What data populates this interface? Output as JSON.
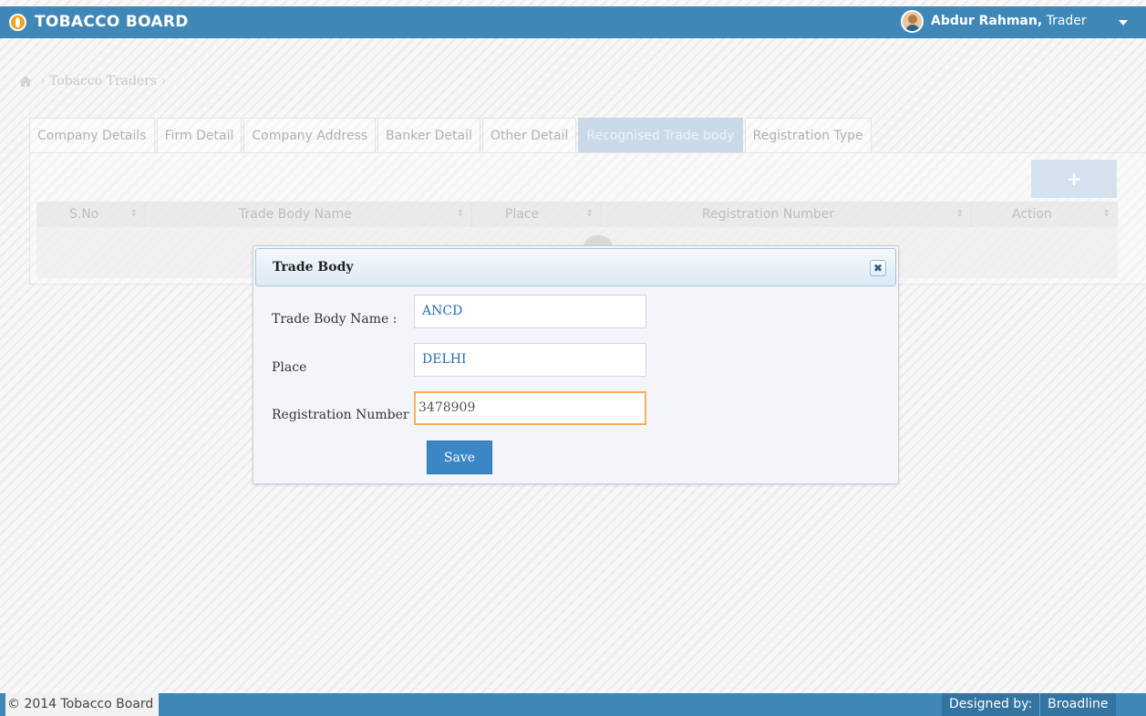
{
  "header": {
    "app_title": "TOBACCO BOARD",
    "user_name": "Abdur Rahman,",
    "user_role": "Trader"
  },
  "breadcrumb": {
    "items": [
      "Tobacco Traders"
    ]
  },
  "tabs": [
    {
      "label": "Company Details",
      "active": false
    },
    {
      "label": "Firm Detail",
      "active": false
    },
    {
      "label": "Company Address",
      "active": false
    },
    {
      "label": "Banker Detail",
      "active": false
    },
    {
      "label": "Other Detail",
      "active": false
    },
    {
      "label": "Recognised Trade body",
      "active": true
    },
    {
      "label": "Registration Type",
      "active": false
    }
  ],
  "table": {
    "add_label": "+",
    "columns": [
      "S.No",
      "Trade Body Name",
      "Place",
      "Registration Number",
      "Action"
    ],
    "rows": []
  },
  "modal": {
    "title": "Trade Body",
    "close_label": "✖",
    "fields": [
      {
        "label": "Trade Body Name :",
        "value": "ANCD"
      },
      {
        "label": "Place",
        "value": "DELHI"
      },
      {
        "label": "Registration Number :",
        "value": "3478909"
      }
    ],
    "save_label": "Save"
  },
  "footer": {
    "copyright": "© 2014 Tobacco Board",
    "designed_by_label": "Designed by:",
    "designer": "Broadline"
  },
  "colors": {
    "brand_blue": "#3f87b7",
    "active_tab": "#c9d9e7",
    "save_button": "#3b86c4",
    "focus_border": "#f4b05a",
    "logo_orange": "#f4a11c"
  },
  "icons": [
    "tobacco-leaf-logo-icon",
    "user-avatar-icon",
    "caret-down-icon",
    "home-icon",
    "plus-icon",
    "sort-icon",
    "close-icon"
  ]
}
